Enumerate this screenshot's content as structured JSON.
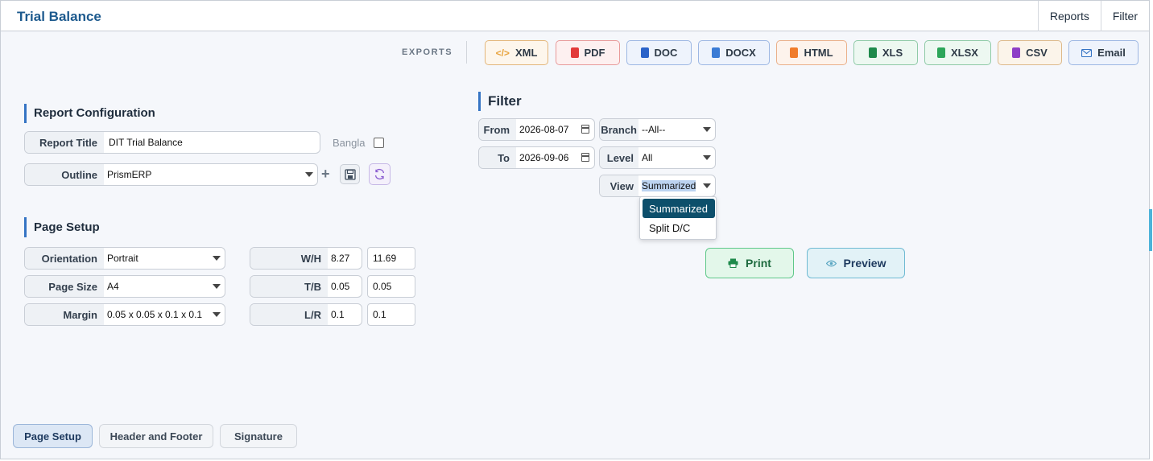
{
  "header": {
    "title": "Trial Balance",
    "nav": [
      "Reports",
      "Filter"
    ]
  },
  "exports": {
    "label": "EXPORTS",
    "buttons": [
      {
        "label": "XML",
        "icon": "code-icon",
        "color": "#e8a33d"
      },
      {
        "label": "PDF",
        "icon": "pdf-file-icon",
        "color": "#e23b3b"
      },
      {
        "label": "DOC",
        "icon": "doc-file-icon",
        "color": "#2b63c9"
      },
      {
        "label": "DOCX",
        "icon": "docx-file-icon",
        "color": "#3a7bd5"
      },
      {
        "label": "HTML",
        "icon": "html-file-icon",
        "color": "#f07c2b"
      },
      {
        "label": "XLS",
        "icon": "xls-file-icon",
        "color": "#1f8a4c"
      },
      {
        "label": "XLSX",
        "icon": "xlsx-file-icon",
        "color": "#2da65a"
      },
      {
        "label": "CSV",
        "icon": "csv-file-icon",
        "color": "#8e3fc7"
      },
      {
        "label": "Email",
        "icon": "mail-icon",
        "color": "#3574c4"
      }
    ]
  },
  "report_config": {
    "section_title": "Report Configuration",
    "report_title_label": "Report Title",
    "report_title_value": "DIT Trial Balance",
    "bangla_label": "Bangla",
    "outline_label": "Outline",
    "outline_value": "PrismERP"
  },
  "page_setup": {
    "section_title": "Page Setup",
    "orientation_label": "Orientation",
    "orientation_value": "Portrait",
    "page_size_label": "Page Size",
    "page_size_value": "A4",
    "margin_label": "Margin",
    "margin_value": "0.05 x 0.05 x 0.1 x 0.1",
    "wh_label": "W/H",
    "w_value": "8.27",
    "h_value": "11.69",
    "tb_label": "T/B",
    "t_value": "0.05",
    "b_value": "0.05",
    "lr_label": "L/R",
    "l_value": "0.1",
    "r_value": "0.1"
  },
  "filter": {
    "section_title": "Filter",
    "from_label": "From",
    "from_value": "2026-08-07",
    "to_label": "To",
    "to_value": "2026-09-06",
    "branch_label": "Branch",
    "branch_value": "--All--",
    "level_label": "Level",
    "level_value": "All",
    "view_label": "View",
    "view_value": "Summarized",
    "view_options": [
      "Summarized",
      "Split D/C"
    ]
  },
  "actions": {
    "print_label": "Print",
    "preview_label": "Preview"
  },
  "tabs": [
    {
      "label": "Page Setup"
    },
    {
      "label": "Header and Footer"
    },
    {
      "label": "Signature"
    }
  ]
}
